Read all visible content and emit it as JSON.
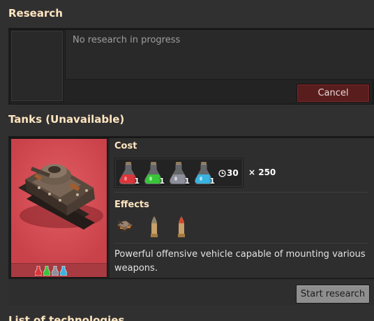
{
  "research": {
    "heading": "Research",
    "status_text": "No research in progress",
    "cancel_label": "Cancel"
  },
  "technology": {
    "heading": "Tanks (Unavailable)",
    "cost_heading": "Cost",
    "ingredients": [
      {
        "icon": "automation-science-pack-icon",
        "color": "#d9363b",
        "amount": "1"
      },
      {
        "icon": "logistic-science-pack-icon",
        "color": "#39c43a",
        "amount": "1"
      },
      {
        "icon": "military-science-pack-icon",
        "color": "#8d8f9a",
        "amount": "1"
      },
      {
        "icon": "chemical-science-pack-icon",
        "color": "#39b3e0",
        "amount": "1"
      }
    ],
    "time": "30",
    "count": "× 250",
    "effects_heading": "Effects",
    "effects": [
      {
        "icon": "tank-unlock-icon"
      },
      {
        "icon": "cannon-shell-unlock-icon"
      },
      {
        "icon": "explosive-cannon-shell-unlock-icon"
      }
    ],
    "description": "Powerful offensive vehicle capable of mounting various weapons.",
    "start_label": "Start research",
    "accent": "#d2484f"
  },
  "list": {
    "heading": "List of technologies"
  }
}
